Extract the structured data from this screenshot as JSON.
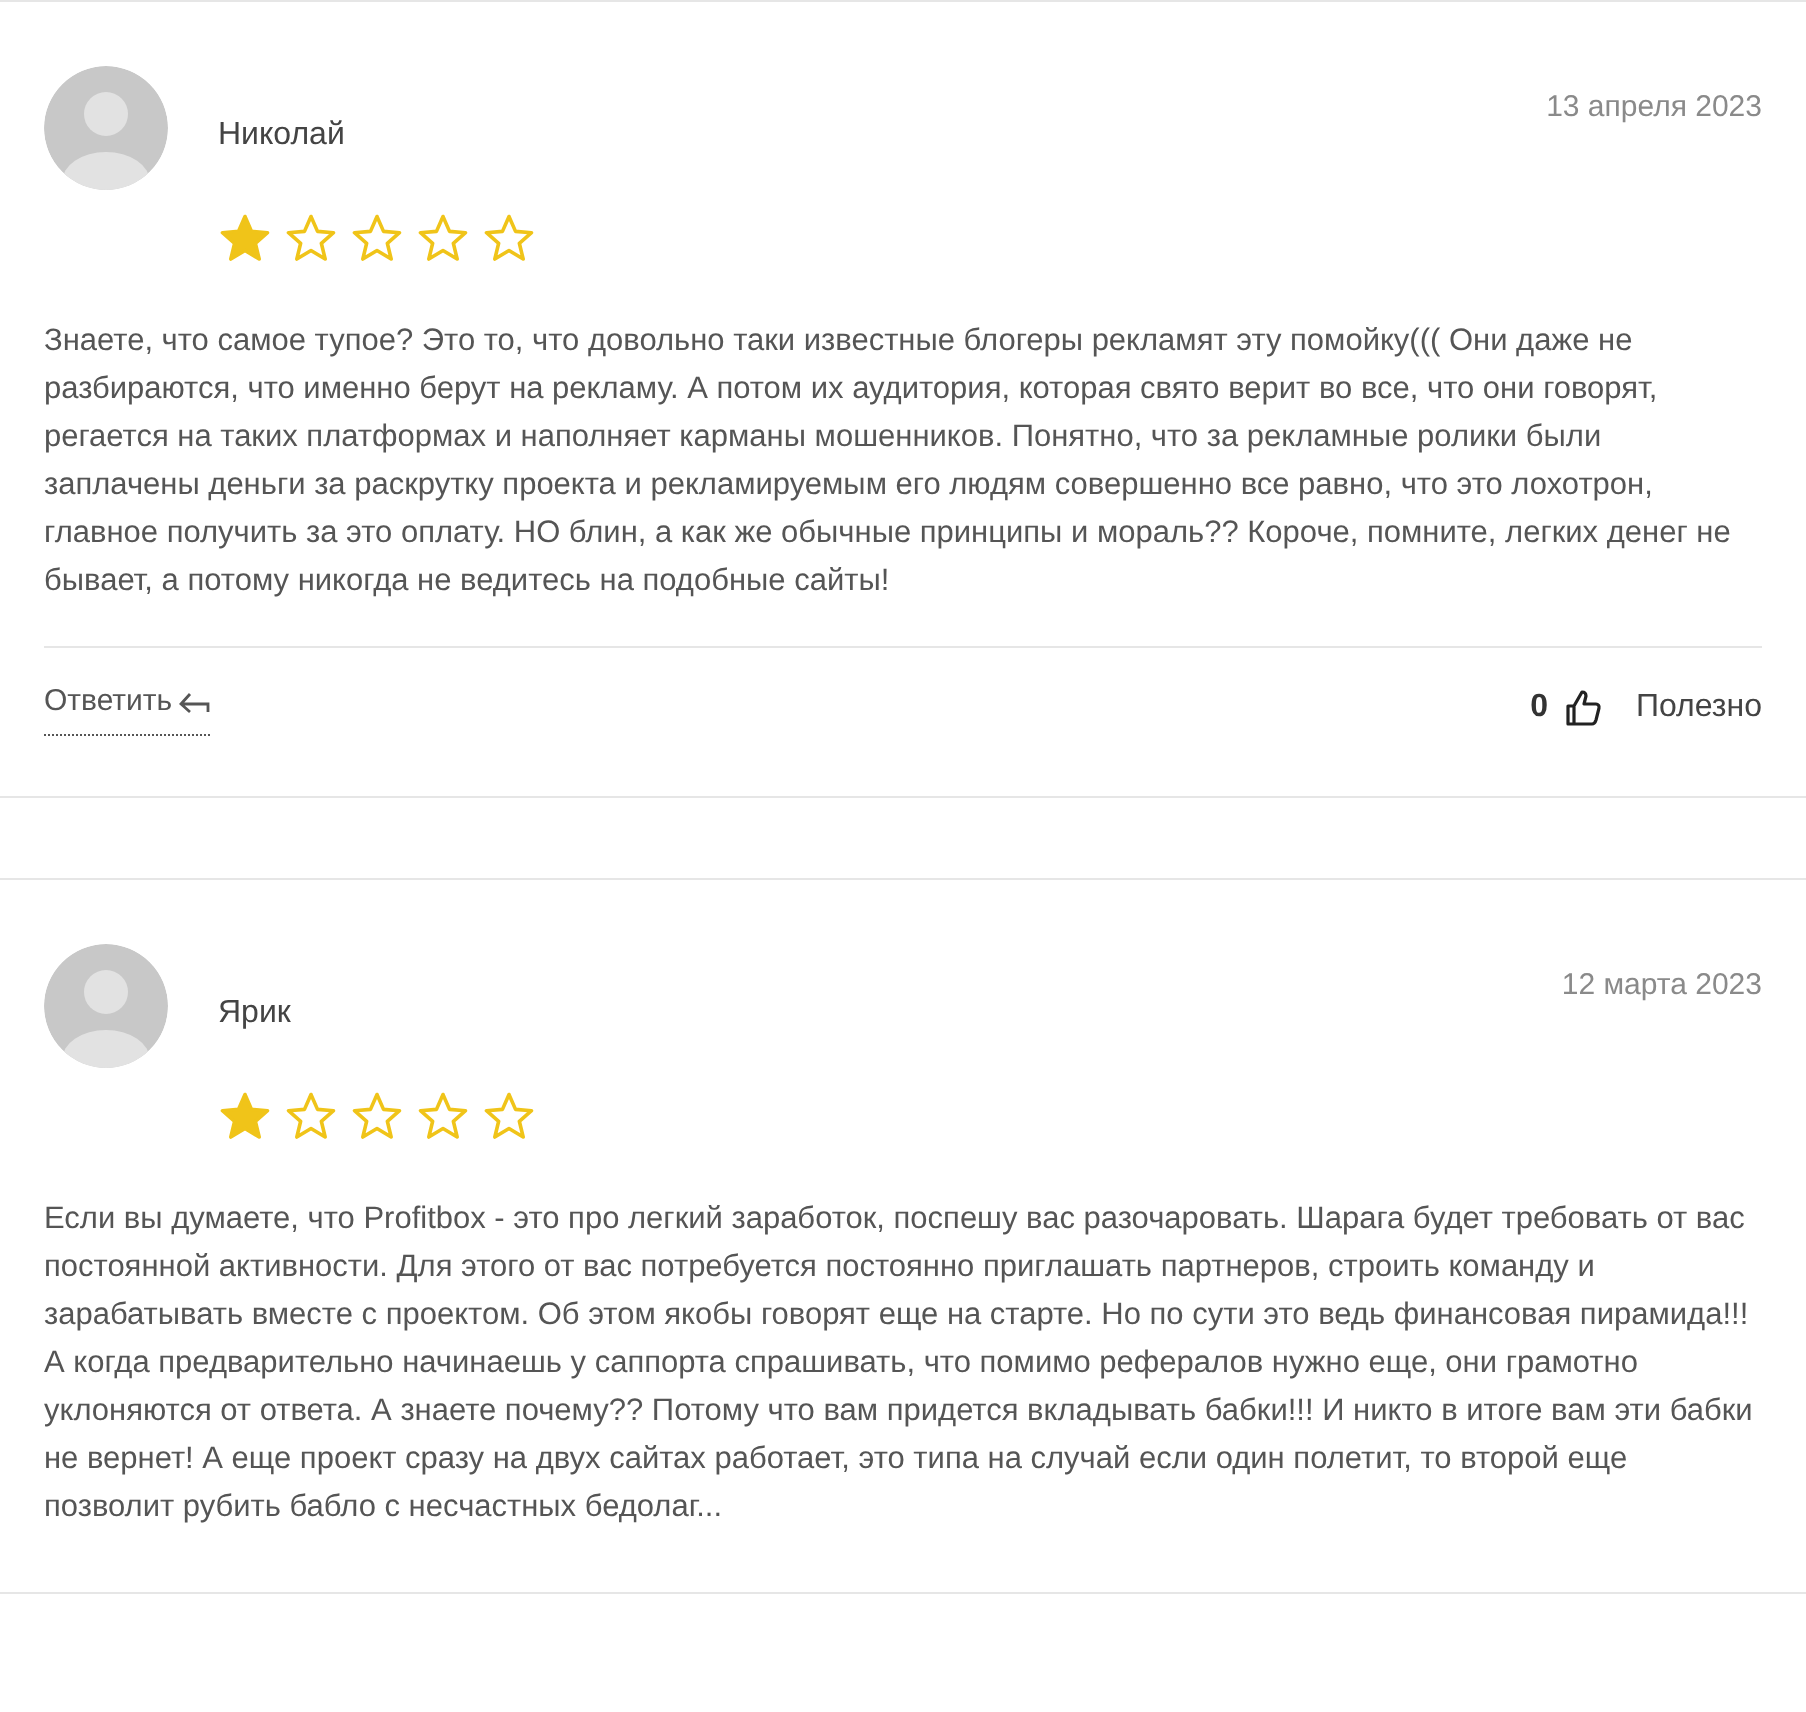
{
  "reviews": [
    {
      "author": "Николай",
      "date": "13 апреля 2023",
      "stars": 1,
      "text": "Знаете, что самое тупое? Это то, что довольно таки известные блогеры рекламят эту помойку((( Они даже не разбираются, что именно берут на рекламу. А потом их аудитория, которая свято верит во все, что они говорят, регается на таких платформах и наполняет карманы мошенников. Понятно, что за рекламные ролики были заплачены деньги за раскрутку проекта и рекламируемым его людям совершенно все равно, что это лохотрон, главное получить за это оплату. НО блин, а как же обычные принципы и мораль?? Короче, помните, легких денег не бывает, а потому никогда не ведитесь на подобные сайты!",
      "footer": {
        "reply": "Ответить",
        "likes": "0",
        "useful": "Полезно"
      }
    },
    {
      "author": "Ярик",
      "date": "12 марта 2023",
      "stars": 1,
      "text": "Если вы думаете, что Profitbox - это про легкий заработок, поспешу вас разочаровать. Шарага будет требовать от вас постоянной активности. Для этого от вас потребуется постоянно приглашать партнеров, строить команду и зарабатывать вместе с проектом. Об этом якобы говорят еще на старте. Но по сути это ведь финансовая пирамида!!! А когда предварительно начинаешь у саппорта спрашивать, что помимо рефералов нужно еще, они грамотно уклоняются от ответа. А знаете почему?? Потому что вам придется вкладывать бабки!!! И никто в итоге вам эти бабки не вернет! А еще проект сразу на двух сайтах работает, это типа на случай если один полетит, то второй еще позволит рубить бабло с несчастных бедолаг..."
    }
  ]
}
